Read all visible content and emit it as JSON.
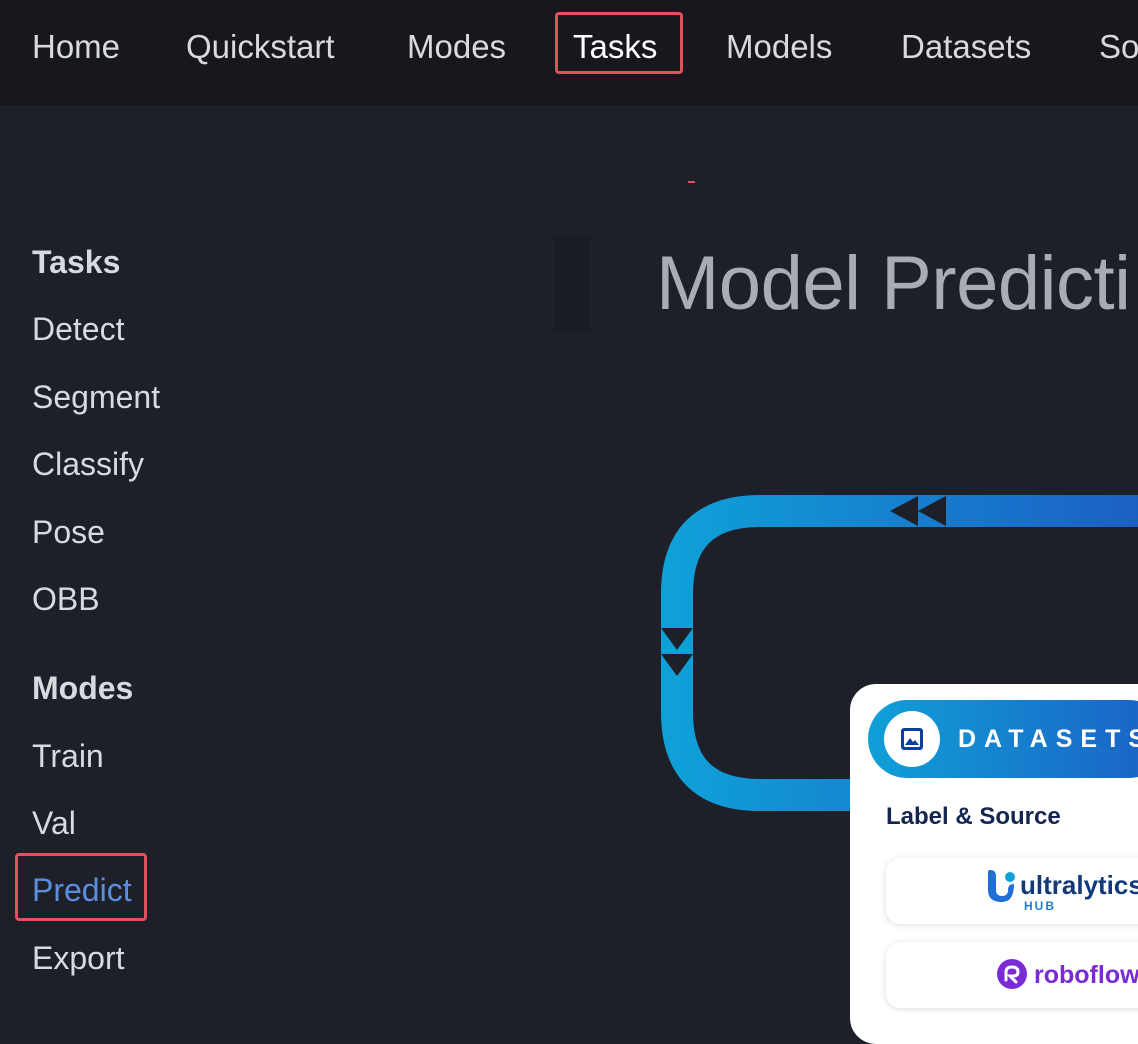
{
  "topnav": {
    "tabs": [
      {
        "label": "Home"
      },
      {
        "label": "Quickstart"
      },
      {
        "label": "Modes"
      },
      {
        "label": "Tasks",
        "active": true
      },
      {
        "label": "Models"
      },
      {
        "label": "Datasets"
      },
      {
        "label": "So"
      }
    ]
  },
  "sidebar": {
    "sections": [
      {
        "title": "Tasks",
        "items": [
          "Detect",
          "Segment",
          "Classify",
          "Pose",
          "OBB"
        ]
      },
      {
        "title": "Modes",
        "items": [
          "Train",
          "Val",
          "Predict",
          "Export"
        ],
        "active": "Predict"
      }
    ]
  },
  "main": {
    "title": "Model Predicti"
  },
  "diagram": {
    "card": {
      "title": "DATASETS",
      "subtitle": "Label & Source",
      "sources": [
        {
          "name": "ultralytics",
          "tag": "HUB"
        },
        {
          "name": "roboflow"
        }
      ]
    }
  },
  "colors": {
    "nav_bg": "#16181d",
    "page_bg": "#1e2029",
    "highlight": "#e5505f",
    "active_link": "#5b8fde",
    "diagram_blue_start": "#0fa0d8",
    "diagram_blue_end": "#1c5fc4"
  }
}
